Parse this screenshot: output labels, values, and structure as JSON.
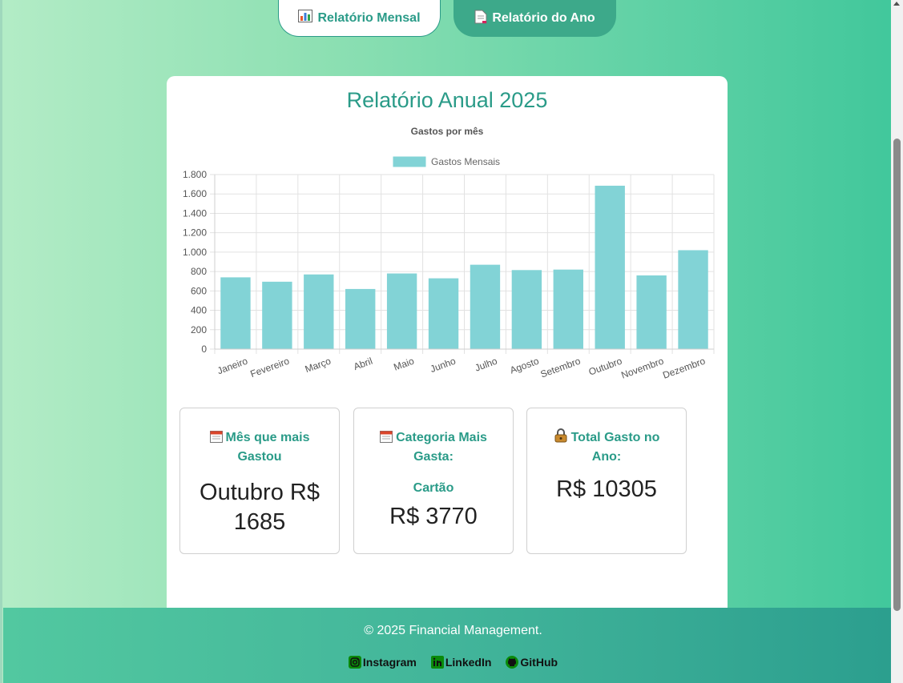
{
  "nav": {
    "monthly_label": "Relatório Mensal",
    "monthly_icon": "bar-chart-icon",
    "year_label": "Relatório do Ano",
    "year_icon": "document-icon"
  },
  "report": {
    "title": "Relatório Anual 2025"
  },
  "chart_data": {
    "type": "bar",
    "title": "Gastos por mês",
    "legend_position": "top",
    "grid": true,
    "categories": [
      "Janeiro",
      "Fevereiro",
      "Março",
      "Abril",
      "Maio",
      "Junho",
      "Julho",
      "Agosto",
      "Setembro",
      "Outubro",
      "Novembro",
      "Dezembro"
    ],
    "series": [
      {
        "name": "Gastos Mensais",
        "values": [
          740,
          695,
          770,
          620,
          780,
          730,
          870,
          815,
          820,
          1685,
          760,
          1020
        ],
        "color": "#82d3d6"
      }
    ],
    "yticks": [
      "0",
      "200",
      "400",
      "600",
      "800",
      "1.000",
      "1.200",
      "1.400",
      "1.600",
      "1.800"
    ],
    "ylim": [
      0,
      1800
    ]
  },
  "stats": {
    "top_month": {
      "icon": "calendar-icon",
      "label": "Mês que mais Gastou",
      "value": "Outubro R$ 1685"
    },
    "top_category": {
      "icon": "calendar-icon",
      "label": "Categoria Mais Gasta:",
      "category": "Cartão",
      "value": "R$ 3770"
    },
    "total": {
      "icon": "lock-icon",
      "label": "Total Gasto no Ano:",
      "value": "R$ 10305"
    }
  },
  "footer": {
    "copyright": "© 2025 Financial Management.",
    "links": [
      {
        "label": "Instagram",
        "icon": "instagram-icon"
      },
      {
        "label": "LinkedIn",
        "icon": "linkedin-icon"
      },
      {
        "label": "GitHub",
        "icon": "github-icon"
      }
    ]
  },
  "colors": {
    "accent": "#2a9b88",
    "bar": "#82d3d6",
    "footer_start": "#52c8a0",
    "footer_end": "#2b9e8e"
  }
}
